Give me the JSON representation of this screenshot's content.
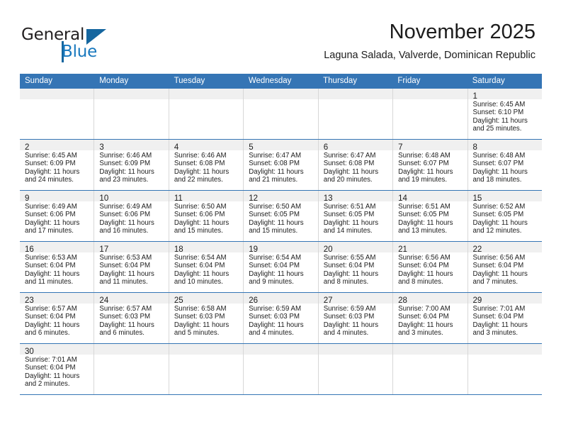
{
  "brand": {
    "name_part1": "General",
    "name_part2": "Blue",
    "triangle_color": "#15669f",
    "blue_color": "#1878be"
  },
  "header": {
    "title": "November 2025",
    "subtitle": "Laguna Salada, Valverde, Dominican Republic"
  },
  "theme": {
    "header_bg": "#3575b5",
    "header_text": "#ffffff",
    "daynum_bg": "#f0f0f0",
    "cell_border": "#d7d7d7",
    "week_separator": "#3575b5"
  },
  "weekdays": [
    "Sunday",
    "Monday",
    "Tuesday",
    "Wednesday",
    "Thursday",
    "Friday",
    "Saturday"
  ],
  "weeks": [
    [
      {
        "day": "",
        "lines": []
      },
      {
        "day": "",
        "lines": []
      },
      {
        "day": "",
        "lines": []
      },
      {
        "day": "",
        "lines": []
      },
      {
        "day": "",
        "lines": []
      },
      {
        "day": "",
        "lines": []
      },
      {
        "day": "1",
        "lines": [
          "Sunrise: 6:45 AM",
          "Sunset: 6:10 PM",
          "Daylight: 11 hours",
          "and 25 minutes."
        ]
      }
    ],
    [
      {
        "day": "2",
        "lines": [
          "Sunrise: 6:45 AM",
          "Sunset: 6:09 PM",
          "Daylight: 11 hours",
          "and 24 minutes."
        ]
      },
      {
        "day": "3",
        "lines": [
          "Sunrise: 6:46 AM",
          "Sunset: 6:09 PM",
          "Daylight: 11 hours",
          "and 23 minutes."
        ]
      },
      {
        "day": "4",
        "lines": [
          "Sunrise: 6:46 AM",
          "Sunset: 6:08 PM",
          "Daylight: 11 hours",
          "and 22 minutes."
        ]
      },
      {
        "day": "5",
        "lines": [
          "Sunrise: 6:47 AM",
          "Sunset: 6:08 PM",
          "Daylight: 11 hours",
          "and 21 minutes."
        ]
      },
      {
        "day": "6",
        "lines": [
          "Sunrise: 6:47 AM",
          "Sunset: 6:08 PM",
          "Daylight: 11 hours",
          "and 20 minutes."
        ]
      },
      {
        "day": "7",
        "lines": [
          "Sunrise: 6:48 AM",
          "Sunset: 6:07 PM",
          "Daylight: 11 hours",
          "and 19 minutes."
        ]
      },
      {
        "day": "8",
        "lines": [
          "Sunrise: 6:48 AM",
          "Sunset: 6:07 PM",
          "Daylight: 11 hours",
          "and 18 minutes."
        ]
      }
    ],
    [
      {
        "day": "9",
        "lines": [
          "Sunrise: 6:49 AM",
          "Sunset: 6:06 PM",
          "Daylight: 11 hours",
          "and 17 minutes."
        ]
      },
      {
        "day": "10",
        "lines": [
          "Sunrise: 6:49 AM",
          "Sunset: 6:06 PM",
          "Daylight: 11 hours",
          "and 16 minutes."
        ]
      },
      {
        "day": "11",
        "lines": [
          "Sunrise: 6:50 AM",
          "Sunset: 6:06 PM",
          "Daylight: 11 hours",
          "and 15 minutes."
        ]
      },
      {
        "day": "12",
        "lines": [
          "Sunrise: 6:50 AM",
          "Sunset: 6:05 PM",
          "Daylight: 11 hours",
          "and 15 minutes."
        ]
      },
      {
        "day": "13",
        "lines": [
          "Sunrise: 6:51 AM",
          "Sunset: 6:05 PM",
          "Daylight: 11 hours",
          "and 14 minutes."
        ]
      },
      {
        "day": "14",
        "lines": [
          "Sunrise: 6:51 AM",
          "Sunset: 6:05 PM",
          "Daylight: 11 hours",
          "and 13 minutes."
        ]
      },
      {
        "day": "15",
        "lines": [
          "Sunrise: 6:52 AM",
          "Sunset: 6:05 PM",
          "Daylight: 11 hours",
          "and 12 minutes."
        ]
      }
    ],
    [
      {
        "day": "16",
        "lines": [
          "Sunrise: 6:53 AM",
          "Sunset: 6:04 PM",
          "Daylight: 11 hours",
          "and 11 minutes."
        ]
      },
      {
        "day": "17",
        "lines": [
          "Sunrise: 6:53 AM",
          "Sunset: 6:04 PM",
          "Daylight: 11 hours",
          "and 11 minutes."
        ]
      },
      {
        "day": "18",
        "lines": [
          "Sunrise: 6:54 AM",
          "Sunset: 6:04 PM",
          "Daylight: 11 hours",
          "and 10 minutes."
        ]
      },
      {
        "day": "19",
        "lines": [
          "Sunrise: 6:54 AM",
          "Sunset: 6:04 PM",
          "Daylight: 11 hours",
          "and 9 minutes."
        ]
      },
      {
        "day": "20",
        "lines": [
          "Sunrise: 6:55 AM",
          "Sunset: 6:04 PM",
          "Daylight: 11 hours",
          "and 8 minutes."
        ]
      },
      {
        "day": "21",
        "lines": [
          "Sunrise: 6:56 AM",
          "Sunset: 6:04 PM",
          "Daylight: 11 hours",
          "and 8 minutes."
        ]
      },
      {
        "day": "22",
        "lines": [
          "Sunrise: 6:56 AM",
          "Sunset: 6:04 PM",
          "Daylight: 11 hours",
          "and 7 minutes."
        ]
      }
    ],
    [
      {
        "day": "23",
        "lines": [
          "Sunrise: 6:57 AM",
          "Sunset: 6:04 PM",
          "Daylight: 11 hours",
          "and 6 minutes."
        ]
      },
      {
        "day": "24",
        "lines": [
          "Sunrise: 6:57 AM",
          "Sunset: 6:03 PM",
          "Daylight: 11 hours",
          "and 6 minutes."
        ]
      },
      {
        "day": "25",
        "lines": [
          "Sunrise: 6:58 AM",
          "Sunset: 6:03 PM",
          "Daylight: 11 hours",
          "and 5 minutes."
        ]
      },
      {
        "day": "26",
        "lines": [
          "Sunrise: 6:59 AM",
          "Sunset: 6:03 PM",
          "Daylight: 11 hours",
          "and 4 minutes."
        ]
      },
      {
        "day": "27",
        "lines": [
          "Sunrise: 6:59 AM",
          "Sunset: 6:03 PM",
          "Daylight: 11 hours",
          "and 4 minutes."
        ]
      },
      {
        "day": "28",
        "lines": [
          "Sunrise: 7:00 AM",
          "Sunset: 6:04 PM",
          "Daylight: 11 hours",
          "and 3 minutes."
        ]
      },
      {
        "day": "29",
        "lines": [
          "Sunrise: 7:01 AM",
          "Sunset: 6:04 PM",
          "Daylight: 11 hours",
          "and 3 minutes."
        ]
      }
    ],
    [
      {
        "day": "30",
        "lines": [
          "Sunrise: 7:01 AM",
          "Sunset: 6:04 PM",
          "Daylight: 11 hours",
          "and 2 minutes."
        ]
      },
      {
        "day": "",
        "lines": []
      },
      {
        "day": "",
        "lines": []
      },
      {
        "day": "",
        "lines": []
      },
      {
        "day": "",
        "lines": []
      },
      {
        "day": "",
        "lines": []
      },
      {
        "day": "",
        "lines": []
      }
    ]
  ]
}
